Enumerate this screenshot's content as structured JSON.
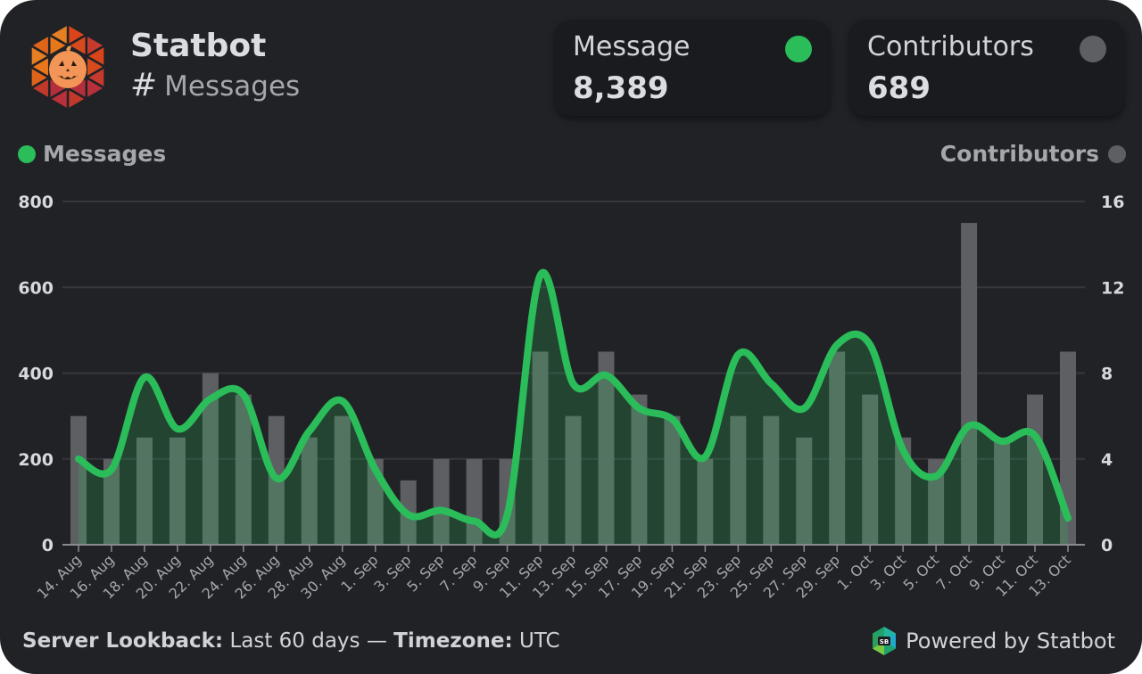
{
  "header": {
    "title": "Statbot",
    "subtitle_icon": "hash-icon",
    "subtitle_hash": "#",
    "subtitle": "Messages",
    "logo": "statbot-halloween-pumpkin-logo"
  },
  "stats": [
    {
      "label": "Message",
      "value": "8,389",
      "color": "#2abd5a"
    },
    {
      "label": "Contributors",
      "value": "689",
      "color": "#5e5f63"
    }
  ],
  "legend": {
    "left": {
      "label": "Messages",
      "color": "#2abd5a"
    },
    "right": {
      "label": "Contributors",
      "color": "#5e5f63"
    }
  },
  "footer": {
    "lookback_label": "Server Lookback:",
    "lookback_value": "Last 60 days",
    "separator": "—",
    "timezone_label": "Timezone:",
    "timezone_value": "UTC",
    "powered_by": "Powered by Statbot"
  },
  "chart_data": {
    "type": "bar",
    "title": "Messages",
    "categories": [
      "14. Aug",
      "16. Aug",
      "18. Aug",
      "20. Aug",
      "22. Aug",
      "24. Aug",
      "26. Aug",
      "28. Aug",
      "30. Aug",
      "1. Sep",
      "3. Sep",
      "5. Sep",
      "7. Sep",
      "9. Sep",
      "11. Sep",
      "13. Sep",
      "15. Sep",
      "17. Sep",
      "19. Sep",
      "21. Sep",
      "23. Sep",
      "25. Sep",
      "27. Sep",
      "29. Sep",
      "1. Oct",
      "3. Oct",
      "5. Oct",
      "7. Oct",
      "9. Oct",
      "11. Oct",
      "13. Oct"
    ],
    "series": [
      {
        "name": "Messages",
        "type": "area-spline",
        "axis": "left",
        "color": "#2abd5a",
        "values": [
          200,
          175,
          390,
          270,
          340,
          350,
          155,
          265,
          335,
          175,
          70,
          80,
          55,
          70,
          628,
          375,
          395,
          318,
          293,
          205,
          443,
          376,
          318,
          466,
          466,
          220,
          160,
          277,
          241,
          254,
          62
        ]
      },
      {
        "name": "Contributors",
        "type": "bar",
        "axis": "right",
        "color": "#5e5f63",
        "values": [
          6,
          4,
          5,
          5,
          8,
          7,
          6,
          5,
          6,
          4,
          3,
          4,
          4,
          4,
          9,
          6,
          9,
          7,
          6,
          4,
          6,
          6,
          5,
          9,
          7,
          5,
          4,
          15,
          5,
          7,
          9
        ]
      }
    ],
    "y_left": {
      "label": "Messages",
      "min": 0,
      "max": 800,
      "ticks": [
        0,
        200,
        400,
        600,
        800
      ]
    },
    "y_right": {
      "label": "Contributors",
      "min": 0,
      "max": 16,
      "ticks": [
        0,
        4,
        8,
        12,
        16
      ]
    },
    "grid": true,
    "legend_placement": "top"
  }
}
